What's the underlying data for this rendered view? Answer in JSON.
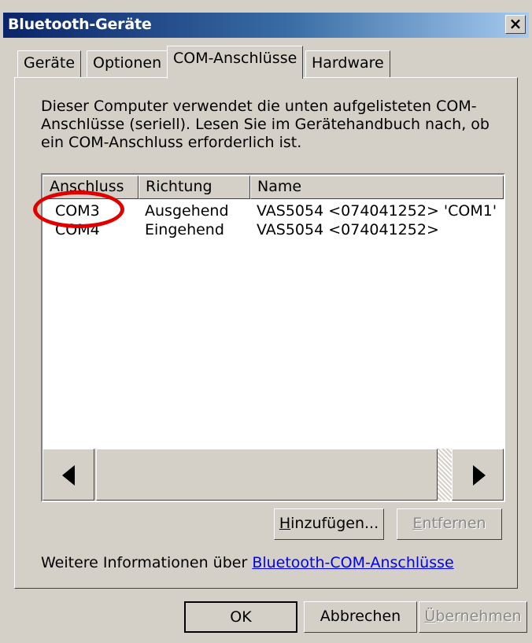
{
  "window": {
    "title": "Bluetooth-Geräte",
    "close_label": "×"
  },
  "tabs": [
    {
      "label": "Geräte",
      "active": false
    },
    {
      "label": "Optionen",
      "active": false
    },
    {
      "label": "COM-Anschlüsse",
      "active": true
    },
    {
      "label": "Hardware",
      "active": false
    }
  ],
  "description": "Dieser Computer verwendet die unten aufgelisteten COM-Anschlüsse (seriell). Lesen Sie im Gerätehandbuch nach, ob ein COM-Anschluss erforderlich ist.",
  "table": {
    "columns": [
      "Anschluss",
      "Richtung",
      "Name"
    ],
    "rows": [
      {
        "port": "COM3",
        "direction": "Ausgehend",
        "name": "VAS5054 <074041252> 'COM1'"
      },
      {
        "port": "COM4",
        "direction": "Eingehend",
        "name": "VAS5054 <074041252>"
      }
    ]
  },
  "scrollbar": {
    "left_icon": "left-triangle-icon",
    "right_icon": "right-triangle-icon"
  },
  "buttons": {
    "add": {
      "label_u": "H",
      "label_rest": "inzufügen..."
    },
    "remove": {
      "label_u": "E",
      "label_rest": "ntfernen"
    },
    "ok": "OK",
    "cancel": "Abbrechen",
    "apply": {
      "label_u": "Ü",
      "label_rest": "bernehmen"
    }
  },
  "info": {
    "text": "Weitere Informationen über",
    "link": "Bluetooth-COM-Anschlüsse"
  },
  "colors": {
    "titlebar": "#0a246a",
    "face": "#d4d0c8",
    "highlight_circle": "#e00000",
    "link": "#0000ee"
  }
}
